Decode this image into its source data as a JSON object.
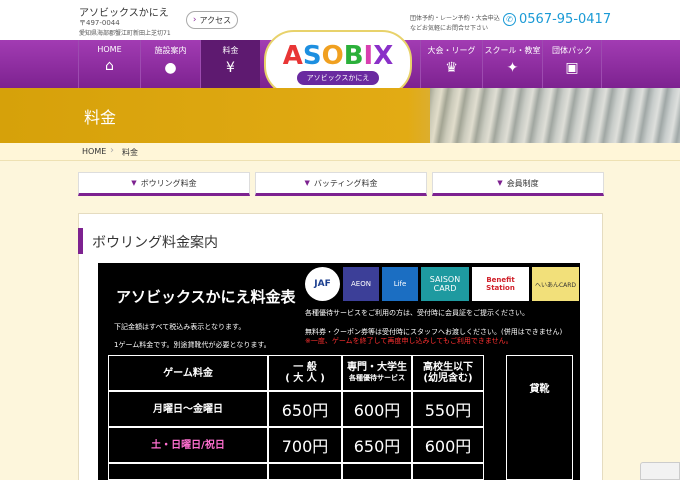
{
  "header": {
    "site_name": "アソビックスかにえ",
    "zip": "〒497-0044",
    "address": "愛知県海部郡蟹江町新田上芝切71",
    "access_label": "アクセス",
    "reserve_line1": "団体予約・レーン予約・大会申込",
    "reserve_line2": "などお気軽にお問合せ下さい",
    "phone": "0567-95-0417"
  },
  "nav": {
    "items": [
      {
        "label": "HOME",
        "icon": "⌂"
      },
      {
        "label": "施設案内",
        "icon": "●"
      },
      {
        "label": "料金",
        "icon": "¥"
      },
      {
        "label": "大会・リーグ",
        "icon": "♛"
      },
      {
        "label": "スクール・教室",
        "icon": "✦"
      },
      {
        "label": "団体パック",
        "icon": "▣"
      }
    ],
    "active": "料金"
  },
  "logo": {
    "letters": [
      "A",
      "S",
      "O",
      "B",
      "I",
      "X"
    ],
    "sub": "アソビックスかにえ"
  },
  "hero": {
    "title": "料金"
  },
  "breadcrumb": {
    "home": "HOME",
    "current": "料金"
  },
  "tabs": [
    {
      "label": "ボウリング料金"
    },
    {
      "label": "バッティング料金"
    },
    {
      "label": "会員制度"
    }
  ],
  "section": {
    "title": "ボウリング料金案内"
  },
  "board": {
    "title": "アソビックスかにえ料金表",
    "note1": "下記金額はすべて税込み表示となります。",
    "note2": "1ゲーム料金です。別途貸靴代が必要となります。",
    "cards": [
      "JAF",
      "AEON",
      "Life",
      "SAISON CARD",
      "Benefit Station",
      "へいあんCARD"
    ],
    "right_note1": "各種優待サービスをご利用の方は、受付時に会員証をご提示ください。",
    "right_note2": "無料券・クーポン券等は受付時にスタッフへお渡しください。(併用はできません)",
    "right_note3": "※一度、ゲームを終了して再度申し込みしてもご利用できません。",
    "table": {
      "header": {
        "game": "ゲーム料金",
        "general_top": "一 般",
        "general_bot": "( 大 人 )",
        "student_top": "専門・大学生",
        "student_bot": "各種優待サービス",
        "highschool_top": "高校生以下",
        "highschool_bot": "(幼児含む)",
        "shoes": "貸靴"
      },
      "rows": [
        {
          "label": "月曜日～金曜日",
          "general": "650円",
          "student": "600円",
          "highschool": "550円"
        },
        {
          "label": "土・日曜日/祝日",
          "general": "700円",
          "student": "650円",
          "highschool": "600円"
        }
      ]
    }
  },
  "colors": {
    "nav_purple": "#7d2290",
    "hero_gold": "#d6a10a",
    "phone_blue": "#1a9ad6",
    "weekend_pink": "#ff6fd0",
    "warn_red": "#ff3030"
  }
}
